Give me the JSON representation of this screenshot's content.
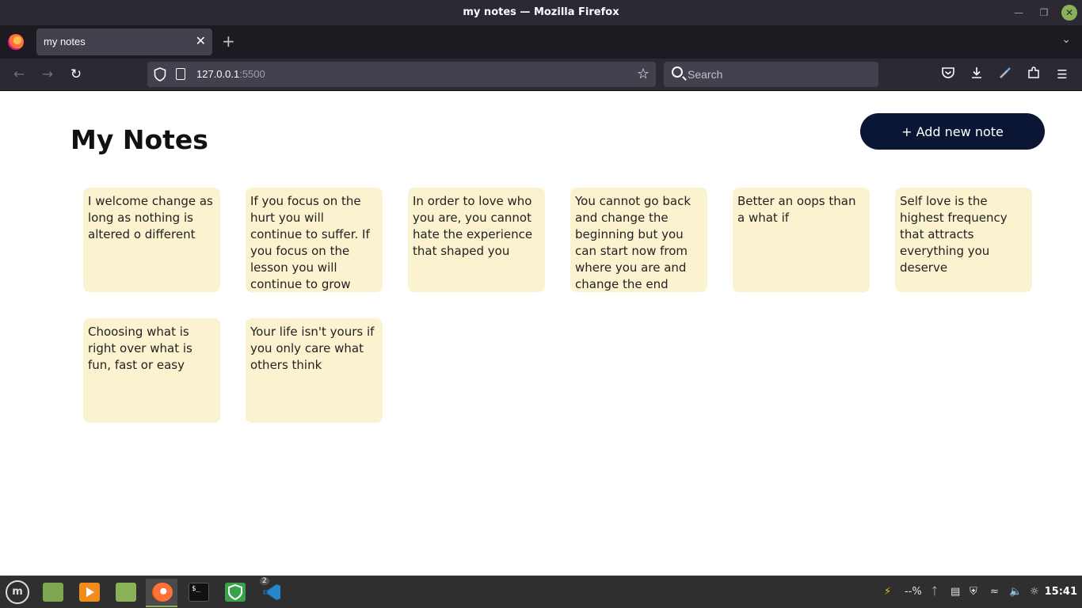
{
  "window": {
    "title": "my notes — Mozilla Firefox"
  },
  "tabs": [
    {
      "label": "my notes"
    }
  ],
  "urlbar": {
    "host": "127.0.0.1",
    "port": ":5500"
  },
  "search": {
    "placeholder": "Search"
  },
  "page": {
    "title": "My Notes",
    "add_button_label": "+ Add new note"
  },
  "notes": [
    {
      "text": "I welcome change as long as nothing is altered o different"
    },
    {
      "text": "If you focus on the hurt you will continue to suffer. If you focus on the lesson you will continue to grow"
    },
    {
      "text": "In order to love who you are, you cannot hate the experience that shaped you"
    },
    {
      "text": "You cannot go back and change the beginning but you can start now from where you are and change the end"
    },
    {
      "text": "Better an oops than a what if"
    },
    {
      "text": "Self love is the highest frequency that attracts everything you deserve"
    },
    {
      "text": "Choosing what is right over what is fun, fast or easy"
    },
    {
      "text": "Your life isn't yours if you only care what others think"
    }
  ],
  "taskbar": {
    "vscode_badge": "2",
    "battery_text": "--%",
    "clock": "15:41"
  },
  "colors": {
    "note_bg": "#fbf3cf",
    "button_bg": "#0b1635",
    "accent": "#8bb158"
  }
}
